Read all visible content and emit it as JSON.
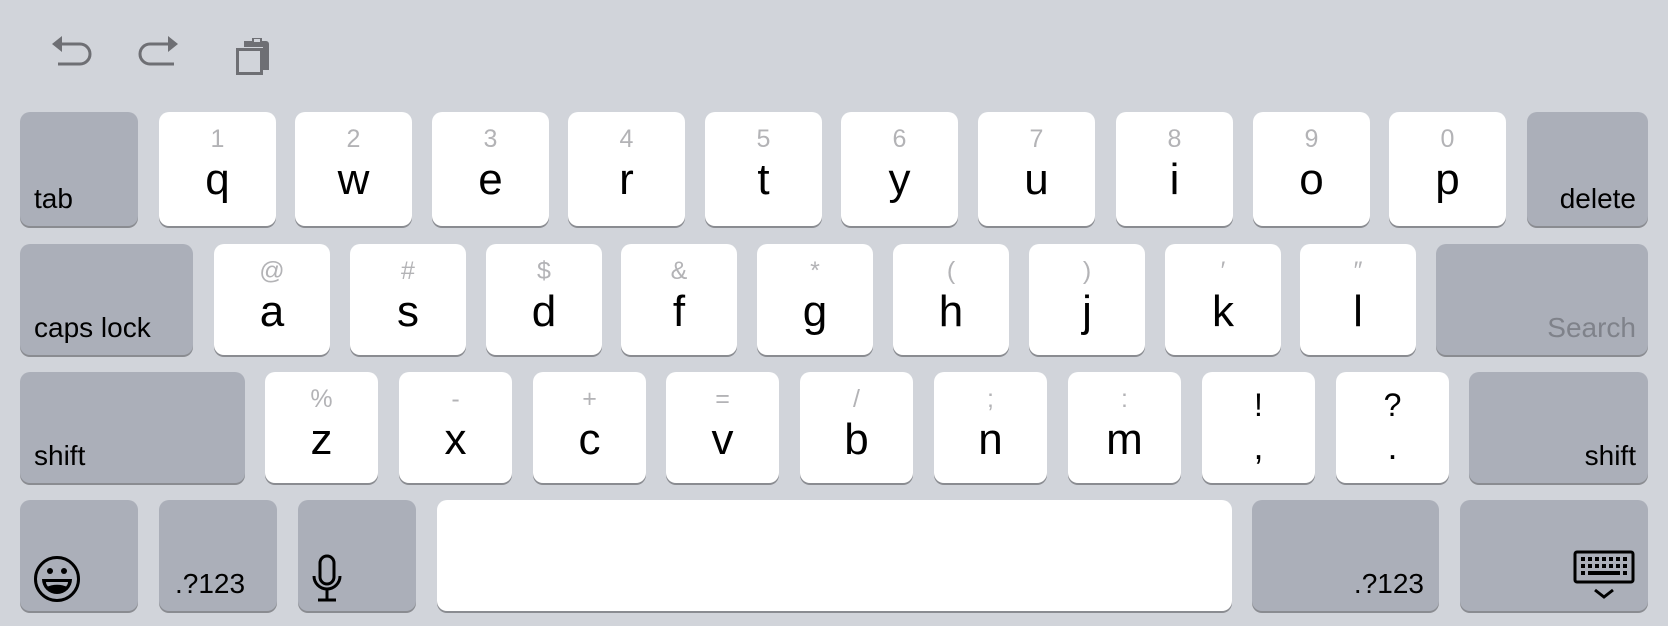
{
  "toolbar": {
    "icons": [
      {
        "name": "undo-icon"
      },
      {
        "name": "redo-icon"
      },
      {
        "name": "paste-icon"
      }
    ]
  },
  "colors": {
    "background": "#d1d4da",
    "letter_key": "#ffffff",
    "function_key": "#abafb9",
    "secondary_text": "#b3b3b6",
    "icon_grey": "#6e6f74"
  },
  "rows": {
    "row1": {
      "tab": "tab",
      "keys": [
        {
          "pri": "q",
          "sec": "1"
        },
        {
          "pri": "w",
          "sec": "2"
        },
        {
          "pri": "e",
          "sec": "3"
        },
        {
          "pri": "r",
          "sec": "4"
        },
        {
          "pri": "t",
          "sec": "5"
        },
        {
          "pri": "y",
          "sec": "6"
        },
        {
          "pri": "u",
          "sec": "7"
        },
        {
          "pri": "i",
          "sec": "8"
        },
        {
          "pri": "o",
          "sec": "9"
        },
        {
          "pri": "p",
          "sec": "0"
        }
      ],
      "delete": "delete"
    },
    "row2": {
      "caps_lock": "caps lock",
      "keys": [
        {
          "pri": "a",
          "sec": "@"
        },
        {
          "pri": "s",
          "sec": "#"
        },
        {
          "pri": "d",
          "sec": "$"
        },
        {
          "pri": "f",
          "sec": "&"
        },
        {
          "pri": "g",
          "sec": "*"
        },
        {
          "pri": "h",
          "sec": "("
        },
        {
          "pri": "j",
          "sec": ")"
        },
        {
          "pri": "k",
          "sec": "′"
        },
        {
          "pri": "l",
          "sec": "″"
        }
      ],
      "return_label": "Search"
    },
    "row3": {
      "shift_left": "shift",
      "keys": [
        {
          "pri": "z",
          "sec": "%"
        },
        {
          "pri": "x",
          "sec": "-"
        },
        {
          "pri": "c",
          "sec": "+"
        },
        {
          "pri": "v",
          "sec": "="
        },
        {
          "pri": "b",
          "sec": "/"
        },
        {
          "pri": "n",
          "sec": ";"
        },
        {
          "pri": "m",
          "sec": ":"
        }
      ],
      "punct_keys": [
        {
          "pri": ",",
          "sec": "!"
        },
        {
          "pri": ".",
          "sec": "?"
        }
      ],
      "shift_right": "shift"
    },
    "row4": {
      "emoji_icon": "emoji-icon",
      "numbers_left": ".?123",
      "mic_icon": "microphone-icon",
      "space_label": "",
      "numbers_right": ".?123",
      "dismiss_icon": "keyboard-dismiss-icon"
    }
  }
}
